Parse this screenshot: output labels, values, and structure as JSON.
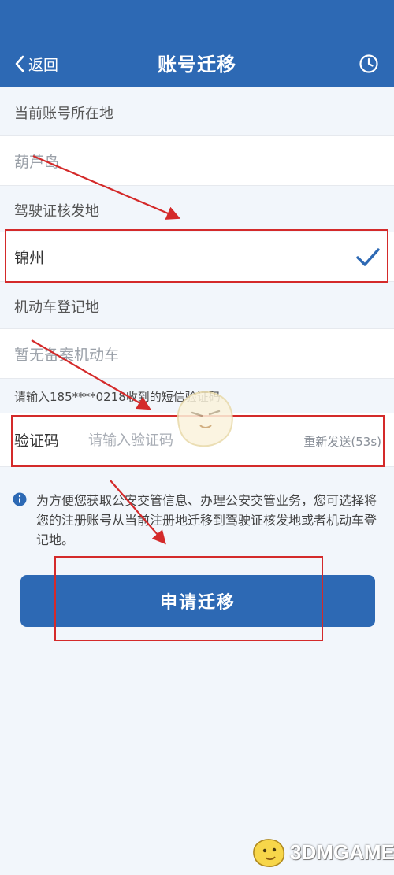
{
  "header": {
    "back_label": "返回",
    "title": "账号迁移",
    "bg_color": "#2d69b4",
    "history_icon": "clock-icon"
  },
  "current_account_location": {
    "label": "当前账号所在地",
    "value": "葫芦岛"
  },
  "license_issuing_place": {
    "label": "驾驶证核发地",
    "value": "锦州",
    "selected": true
  },
  "vehicle_registration_place": {
    "label": "机动车登记地",
    "value": "暂无备案机动车"
  },
  "verification": {
    "hint": "请输入185****0218收到的短信验证码",
    "label": "验证码",
    "placeholder": "请输入验证码",
    "resend_label": "重新发送(53s)"
  },
  "info": {
    "text": "为方便您获取公安交管信息、办理公安交管业务，您可选择将您的注册账号从当前注册地迁移到驾驶证核发地或者机动车登记地。"
  },
  "submit": {
    "label": "申请迁移"
  },
  "watermark": {
    "text": "3DMGAME"
  },
  "colors": {
    "accent": "#2d69b4",
    "annotation": "#d42a2a",
    "background": "#f2f6fb"
  }
}
